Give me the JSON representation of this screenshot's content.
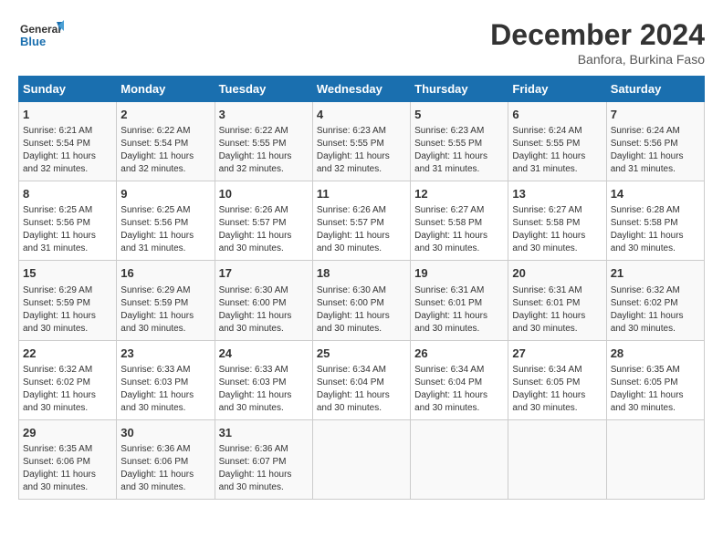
{
  "header": {
    "logo_line1": "General",
    "logo_line2": "Blue",
    "month_title": "December 2024",
    "subtitle": "Banfora, Burkina Faso"
  },
  "days_of_week": [
    "Sunday",
    "Monday",
    "Tuesday",
    "Wednesday",
    "Thursday",
    "Friday",
    "Saturday"
  ],
  "weeks": [
    [
      {
        "day": 1,
        "info": "Sunrise: 6:21 AM\nSunset: 5:54 PM\nDaylight: 11 hours\nand 32 minutes."
      },
      {
        "day": 2,
        "info": "Sunrise: 6:22 AM\nSunset: 5:54 PM\nDaylight: 11 hours\nand 32 minutes."
      },
      {
        "day": 3,
        "info": "Sunrise: 6:22 AM\nSunset: 5:55 PM\nDaylight: 11 hours\nand 32 minutes."
      },
      {
        "day": 4,
        "info": "Sunrise: 6:23 AM\nSunset: 5:55 PM\nDaylight: 11 hours\nand 32 minutes."
      },
      {
        "day": 5,
        "info": "Sunrise: 6:23 AM\nSunset: 5:55 PM\nDaylight: 11 hours\nand 31 minutes."
      },
      {
        "day": 6,
        "info": "Sunrise: 6:24 AM\nSunset: 5:55 PM\nDaylight: 11 hours\nand 31 minutes."
      },
      {
        "day": 7,
        "info": "Sunrise: 6:24 AM\nSunset: 5:56 PM\nDaylight: 11 hours\nand 31 minutes."
      }
    ],
    [
      {
        "day": 8,
        "info": "Sunrise: 6:25 AM\nSunset: 5:56 PM\nDaylight: 11 hours\nand 31 minutes."
      },
      {
        "day": 9,
        "info": "Sunrise: 6:25 AM\nSunset: 5:56 PM\nDaylight: 11 hours\nand 31 minutes."
      },
      {
        "day": 10,
        "info": "Sunrise: 6:26 AM\nSunset: 5:57 PM\nDaylight: 11 hours\nand 30 minutes."
      },
      {
        "day": 11,
        "info": "Sunrise: 6:26 AM\nSunset: 5:57 PM\nDaylight: 11 hours\nand 30 minutes."
      },
      {
        "day": 12,
        "info": "Sunrise: 6:27 AM\nSunset: 5:58 PM\nDaylight: 11 hours\nand 30 minutes."
      },
      {
        "day": 13,
        "info": "Sunrise: 6:27 AM\nSunset: 5:58 PM\nDaylight: 11 hours\nand 30 minutes."
      },
      {
        "day": 14,
        "info": "Sunrise: 6:28 AM\nSunset: 5:58 PM\nDaylight: 11 hours\nand 30 minutes."
      }
    ],
    [
      {
        "day": 15,
        "info": "Sunrise: 6:29 AM\nSunset: 5:59 PM\nDaylight: 11 hours\nand 30 minutes."
      },
      {
        "day": 16,
        "info": "Sunrise: 6:29 AM\nSunset: 5:59 PM\nDaylight: 11 hours\nand 30 minutes."
      },
      {
        "day": 17,
        "info": "Sunrise: 6:30 AM\nSunset: 6:00 PM\nDaylight: 11 hours\nand 30 minutes."
      },
      {
        "day": 18,
        "info": "Sunrise: 6:30 AM\nSunset: 6:00 PM\nDaylight: 11 hours\nand 30 minutes."
      },
      {
        "day": 19,
        "info": "Sunrise: 6:31 AM\nSunset: 6:01 PM\nDaylight: 11 hours\nand 30 minutes."
      },
      {
        "day": 20,
        "info": "Sunrise: 6:31 AM\nSunset: 6:01 PM\nDaylight: 11 hours\nand 30 minutes."
      },
      {
        "day": 21,
        "info": "Sunrise: 6:32 AM\nSunset: 6:02 PM\nDaylight: 11 hours\nand 30 minutes."
      }
    ],
    [
      {
        "day": 22,
        "info": "Sunrise: 6:32 AM\nSunset: 6:02 PM\nDaylight: 11 hours\nand 30 minutes."
      },
      {
        "day": 23,
        "info": "Sunrise: 6:33 AM\nSunset: 6:03 PM\nDaylight: 11 hours\nand 30 minutes."
      },
      {
        "day": 24,
        "info": "Sunrise: 6:33 AM\nSunset: 6:03 PM\nDaylight: 11 hours\nand 30 minutes."
      },
      {
        "day": 25,
        "info": "Sunrise: 6:34 AM\nSunset: 6:04 PM\nDaylight: 11 hours\nand 30 minutes."
      },
      {
        "day": 26,
        "info": "Sunrise: 6:34 AM\nSunset: 6:04 PM\nDaylight: 11 hours\nand 30 minutes."
      },
      {
        "day": 27,
        "info": "Sunrise: 6:34 AM\nSunset: 6:05 PM\nDaylight: 11 hours\nand 30 minutes."
      },
      {
        "day": 28,
        "info": "Sunrise: 6:35 AM\nSunset: 6:05 PM\nDaylight: 11 hours\nand 30 minutes."
      }
    ],
    [
      {
        "day": 29,
        "info": "Sunrise: 6:35 AM\nSunset: 6:06 PM\nDaylight: 11 hours\nand 30 minutes."
      },
      {
        "day": 30,
        "info": "Sunrise: 6:36 AM\nSunset: 6:06 PM\nDaylight: 11 hours\nand 30 minutes."
      },
      {
        "day": 31,
        "info": "Sunrise: 6:36 AM\nSunset: 6:07 PM\nDaylight: 11 hours\nand 30 minutes."
      },
      null,
      null,
      null,
      null
    ]
  ]
}
